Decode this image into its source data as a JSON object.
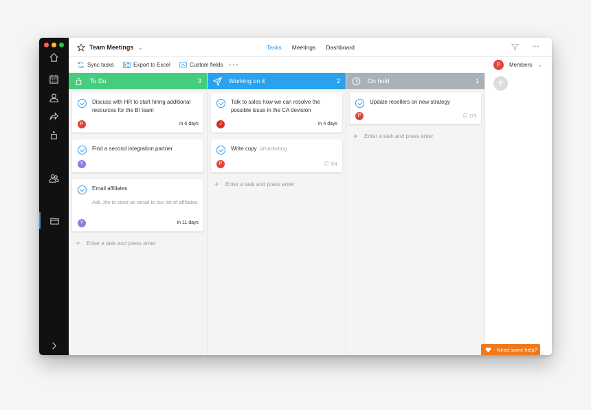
{
  "window": {
    "project_title": "Team Meetings",
    "tabs": [
      {
        "label": "Tasks",
        "active": true
      },
      {
        "label": "Meetings",
        "active": false
      },
      {
        "label": "Dashboard",
        "active": false
      }
    ]
  },
  "toolbar": {
    "sync_label": "Sync tasks",
    "export_label": "Export to Excel",
    "custom_fields_label": "Custom fields",
    "more_label": "∘∘∘",
    "members_label": "Members",
    "members_avatar": "P"
  },
  "colors": {
    "accent": "#2e9bf0",
    "todo": "#45cd7f",
    "working": "#2aa2ee",
    "onhold": "#aab2b8",
    "avatar_p": "#e0453a",
    "avatar_y": "#8e7ce6",
    "avatar_j": "#dd2d1f",
    "help": "#f07a1a"
  },
  "columns": [
    {
      "title": "To Do",
      "count": "3",
      "cards": [
        {
          "title": "Discuss with HR to start hiring additional resources for the BI team",
          "avatar": "P",
          "due": "in 6 days"
        },
        {
          "title": "Find a second integration partner",
          "avatar": "Y"
        },
        {
          "title": "Email affiliates",
          "desc": "Ask Jim to send an email to our list of affiliates",
          "avatar": "Y",
          "due": "in 11 days"
        }
      ],
      "add_placeholder": "Enter a task and press enter"
    },
    {
      "title": "Working on it",
      "count": "2",
      "cards": [
        {
          "title": "Talk to sales how we can resolve the possible issue in the CA devision",
          "avatar": "J",
          "due": "in 4 days"
        },
        {
          "title": "Write copy",
          "tag": "#marketing",
          "avatar": "P",
          "subtasks": "2/4"
        }
      ],
      "add_placeholder": "Enter a task and press enter"
    },
    {
      "title": "On hold",
      "count": "1",
      "cards": [
        {
          "title": "Update resellers on new strategy",
          "avatar": "P",
          "subtasks": "1/3"
        }
      ],
      "add_placeholder": "Enter a task and press enter"
    }
  ],
  "help_label": "Need some help?"
}
